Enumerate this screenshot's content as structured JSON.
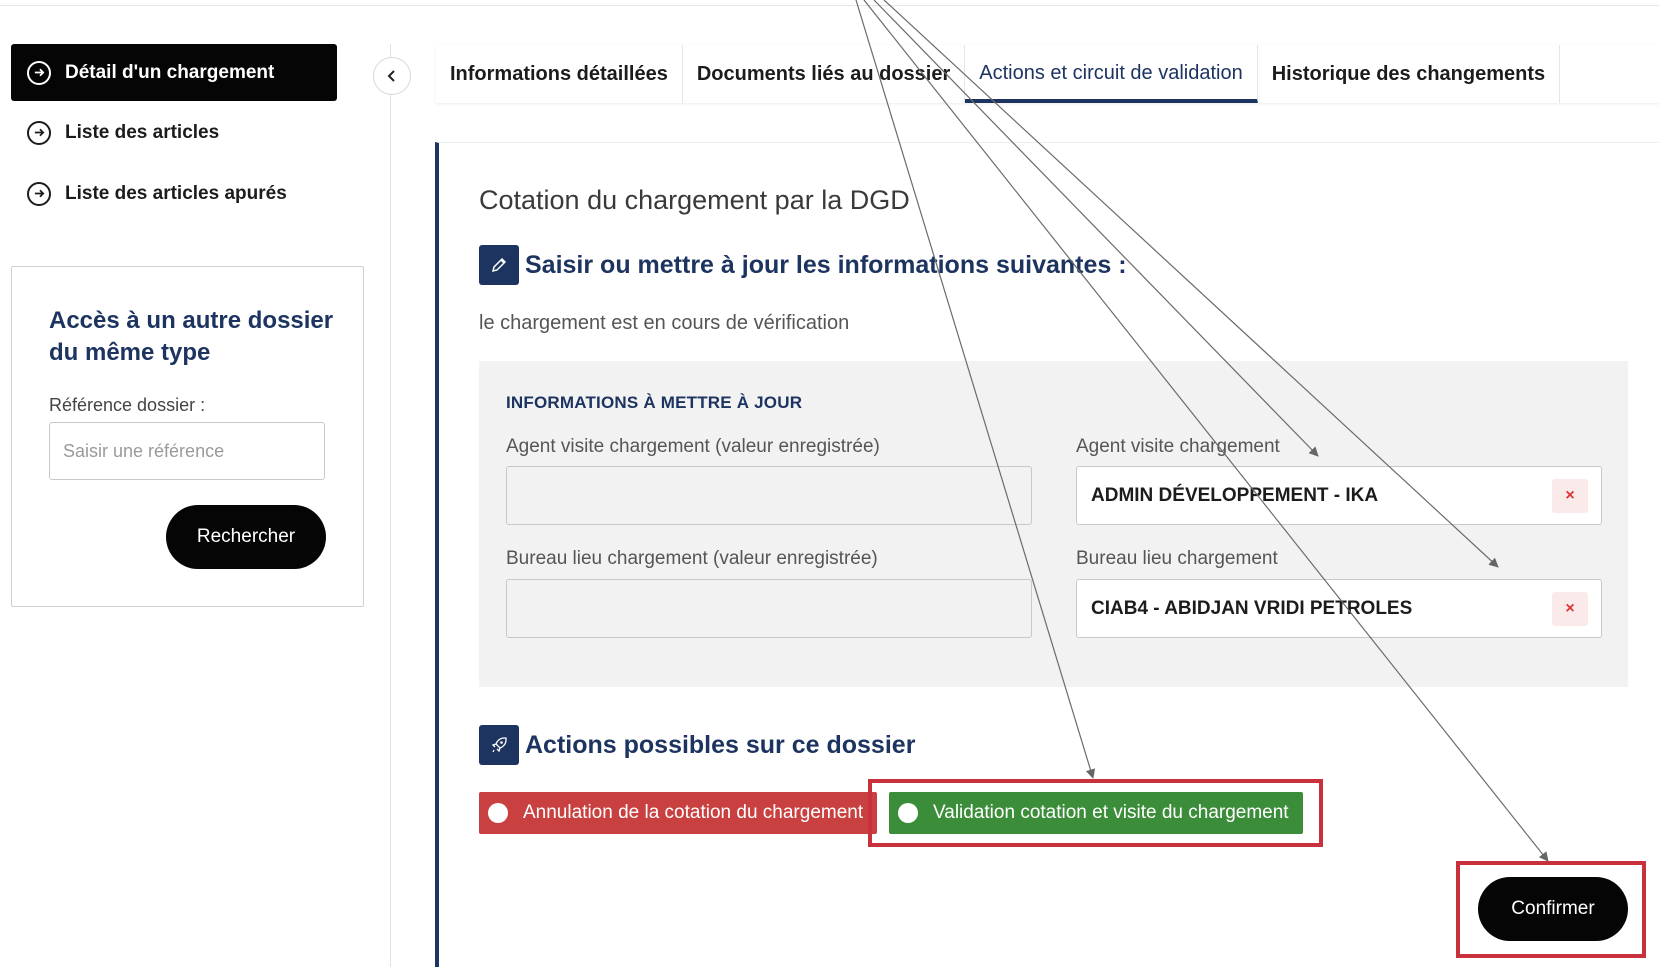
{
  "sidebar": {
    "items": [
      {
        "label": "Détail d'un chargement",
        "active": true
      },
      {
        "label": "Liste des articles",
        "active": false
      },
      {
        "label": "Liste des articles apurés",
        "active": false
      }
    ],
    "search": {
      "title": "Accès à un autre dossier du même type",
      "label": "Référence dossier :",
      "placeholder": "Saisir une référence",
      "button": "Rechercher"
    }
  },
  "tabs": [
    {
      "label": "Informations détaillées",
      "active": false
    },
    {
      "label": "Documents liés au dossier",
      "active": false
    },
    {
      "label": "Actions et circuit de validation",
      "active": true
    },
    {
      "label": "Historique des changements",
      "active": false
    }
  ],
  "main": {
    "section_title": "Cotation du chargement par la DGD",
    "form_heading": "Saisir ou mettre à jour les informations suivantes :",
    "status": "le chargement est en cours de vérification",
    "info_box": {
      "header": "INFORMATIONS À METTRE À JOUR",
      "fields": {
        "agent_saved_label": "Agent visite chargement (valeur enregistrée)",
        "agent_label": "Agent visite chargement",
        "agent_value": "ADMIN DÉVELOPPEMENT - IKA",
        "bureau_saved_label": "Bureau lieu chargement (valeur enregistrée)",
        "bureau_label": "Bureau lieu chargement",
        "bureau_value": "CIAB4 - ABIDJAN VRIDI PETROLES",
        "clear_symbol": "×"
      }
    },
    "actions_heading": "Actions possibles sur ce dossier",
    "actions": {
      "cancel": "Annulation de la cotation du chargement",
      "validate": "Validation cotation et visite du chargement"
    },
    "confirm": "Confirmer"
  },
  "colors": {
    "primary": "#1d3461",
    "danger": "#c94040",
    "success": "#3c8d3a",
    "highlight": "#c8313b",
    "dark": "#050505"
  }
}
